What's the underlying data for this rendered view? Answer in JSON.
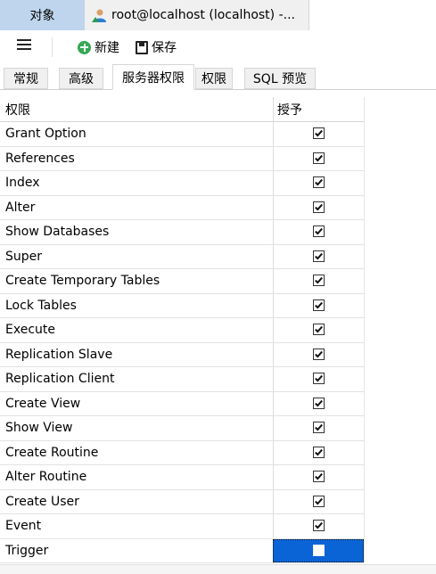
{
  "doc_tabs": {
    "objects": "对象",
    "connection": "root@localhost (localhost) -..."
  },
  "toolbar": {
    "new_label": "新建",
    "save_label": "保存"
  },
  "property_tabs": [
    {
      "label": "常规",
      "active": false
    },
    {
      "label": "高级",
      "active": false
    },
    {
      "label": "服务器权限",
      "active": true
    },
    {
      "label": "权限",
      "active": false
    },
    {
      "label": "SQL 预览",
      "active": false
    }
  ],
  "grid": {
    "headers": {
      "privilege": "权限",
      "grant": "授予"
    },
    "rows": [
      {
        "privilege": "Grant Option",
        "granted": true
      },
      {
        "privilege": "References",
        "granted": true
      },
      {
        "privilege": "Index",
        "granted": true
      },
      {
        "privilege": "Alter",
        "granted": true
      },
      {
        "privilege": "Show Databases",
        "granted": true
      },
      {
        "privilege": "Super",
        "granted": true
      },
      {
        "privilege": "Create Temporary Tables",
        "granted": true
      },
      {
        "privilege": "Lock Tables",
        "granted": true
      },
      {
        "privilege": "Execute",
        "granted": true
      },
      {
        "privilege": "Replication Slave",
        "granted": true
      },
      {
        "privilege": "Replication Client",
        "granted": true
      },
      {
        "privilege": "Create View",
        "granted": true
      },
      {
        "privilege": "Show View",
        "granted": true
      },
      {
        "privilege": "Create Routine",
        "granted": true
      },
      {
        "privilege": "Alter Routine",
        "granted": true
      },
      {
        "privilege": "Create User",
        "granted": true
      },
      {
        "privilege": "Event",
        "granted": true
      },
      {
        "privilege": "Trigger",
        "granted": true,
        "selected": true
      }
    ]
  },
  "colors": {
    "active_doc_tab": "#bfd5ee",
    "selection": "#0a64d6",
    "new_icon": "#34a853"
  },
  "icons": {
    "user": "user-icon",
    "menu": "hamburger-menu-icon",
    "new": "plus-circle-icon",
    "save": "save-disk-icon",
    "check": "checkmark-icon"
  }
}
